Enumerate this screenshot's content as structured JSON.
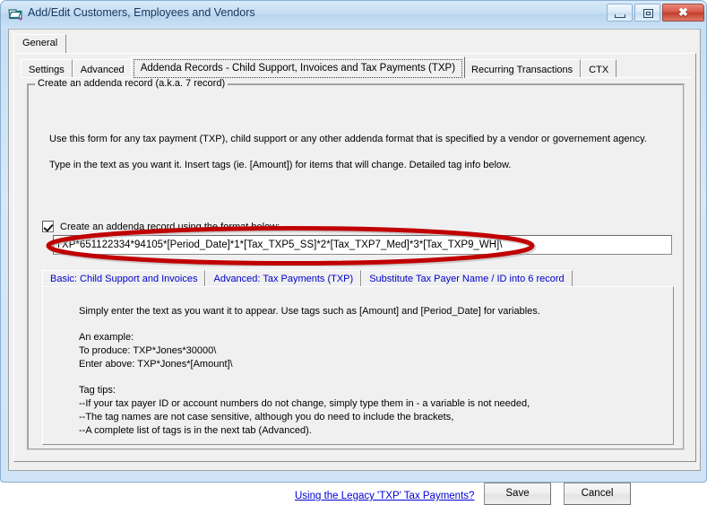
{
  "window": {
    "title": "Add/Edit Customers, Employees and Vendors",
    "icon": "window-folder-icon",
    "controls": {
      "minimize": "minimize-icon",
      "maximize": "maximize-icon",
      "close_glyph": "✖"
    }
  },
  "outer_tabs": [
    {
      "label": "General",
      "active": true
    }
  ],
  "tabs": [
    {
      "label": "Settings",
      "active": false
    },
    {
      "label": "Advanced",
      "active": false
    },
    {
      "label": "Addenda Records - Child Support, Invoices and Tax Payments (TXP)",
      "active": true
    },
    {
      "label": "Recurring Transactions",
      "active": false
    },
    {
      "label": "CTX",
      "active": false
    }
  ],
  "groupbox": {
    "title": "Create an addenda record (a.k.a. 7 record)",
    "intro_line1": "Use this form for any tax payment (TXP), child support or any other addenda format that is specified by a vendor or governement agency.",
    "intro_line2": "Type in the text as you want it.  Insert tags (ie. [Amount]) for items that will change. Detailed tag info below."
  },
  "checkbox": {
    "label": "Create an addenda record using the format below:",
    "checked": true
  },
  "addenda_field": {
    "value": "TXP*651122334*94105*[Period_Date]*1*[Tax_TXP5_SS]*2*[Tax_TXP7_Med]*3*[Tax_TXP9_WH]\\",
    "placeholder": ""
  },
  "inner_tabs": [
    {
      "label": "Basic: Child Support and Invoices",
      "active": true
    },
    {
      "label": "Advanced: Tax Payments (TXP)",
      "active": false
    },
    {
      "label": "Substitute Tax Payer Name / ID into 6 record",
      "active": false
    }
  ],
  "inner_panel": {
    "line1": "Simply enter the text as you want it to appear.  Use tags such as [Amount] and [Period_Date] for variables.",
    "example_header": "An example:",
    "example_produce": "To produce: TXP*Jones*30000\\",
    "example_enter": "Enter above: TXP*Jones*[Amount]\\",
    "tips_header": "Tag tips:",
    "tip1": "--If your tax payer ID or account numbers do not change, simply type them in - a variable is not needed,",
    "tip2": "--The tag names are not case sensitive, although you do need to include the brackets,",
    "tip3": "--A complete list of tags is in the next tab (Advanced)."
  },
  "footer": {
    "legacy_link": "Using the Legacy 'TXP' Tax Payments?",
    "save_label": "Save",
    "cancel_label": "Cancel"
  },
  "annotation": {
    "shape": "red-oval-highlight",
    "color": "#c00000"
  }
}
